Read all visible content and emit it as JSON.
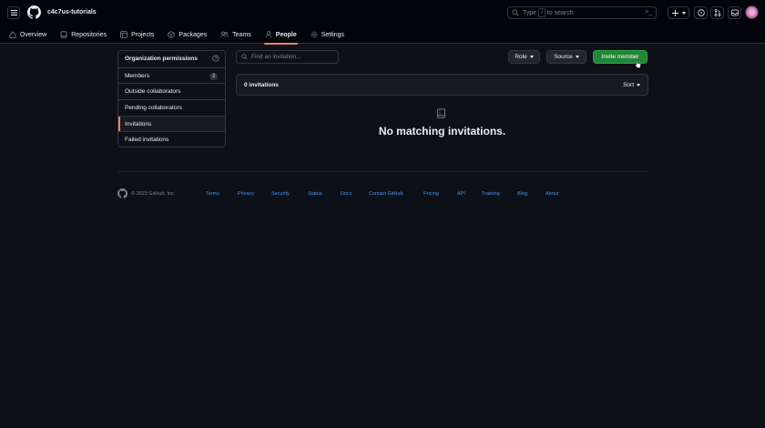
{
  "header": {
    "org_name": "c4c7us-tutorials",
    "search": {
      "prefix": "Type",
      "key": "/",
      "suffix": "to search",
      "cmd": ">_"
    }
  },
  "tabs": [
    {
      "label": "Overview",
      "icon": "home-icon"
    },
    {
      "label": "Repositories",
      "icon": "repo-icon"
    },
    {
      "label": "Projects",
      "icon": "table-icon"
    },
    {
      "label": "Packages",
      "icon": "package-icon"
    },
    {
      "label": "Teams",
      "icon": "people-icon"
    },
    {
      "label": "People",
      "icon": "person-icon",
      "active": true
    },
    {
      "label": "Settings",
      "icon": "gear-icon"
    }
  ],
  "sidebar": {
    "items": [
      {
        "label": "Organization permissions"
      },
      {
        "label": "Members",
        "count": "2"
      },
      {
        "label": "Outside collaborators"
      },
      {
        "label": "Pending collaborators"
      },
      {
        "label": "Invitations",
        "selected": true
      },
      {
        "label": "Failed invitations"
      }
    ]
  },
  "main": {
    "find_placeholder": "Find an invitation...",
    "role_label": "Role",
    "source_label": "Source",
    "invite_label": "Invite member",
    "invitations_count": "0 invitations",
    "sort_label": "Sort",
    "empty_message": "No matching invitations."
  },
  "footer": {
    "copyright": "© 2023 GitHub, Inc.",
    "links": [
      "Terms",
      "Privacy",
      "Security",
      "Status",
      "Docs",
      "Contact GitHub",
      "Pricing",
      "API",
      "Training",
      "Blog",
      "About"
    ]
  },
  "colors": {
    "background": "#0d1117",
    "header_bg": "#010409",
    "border": "#30363d",
    "accent_underline": "#f78166",
    "primary_button": "#238636",
    "link": "#4493f8",
    "muted": "#7d8590"
  }
}
